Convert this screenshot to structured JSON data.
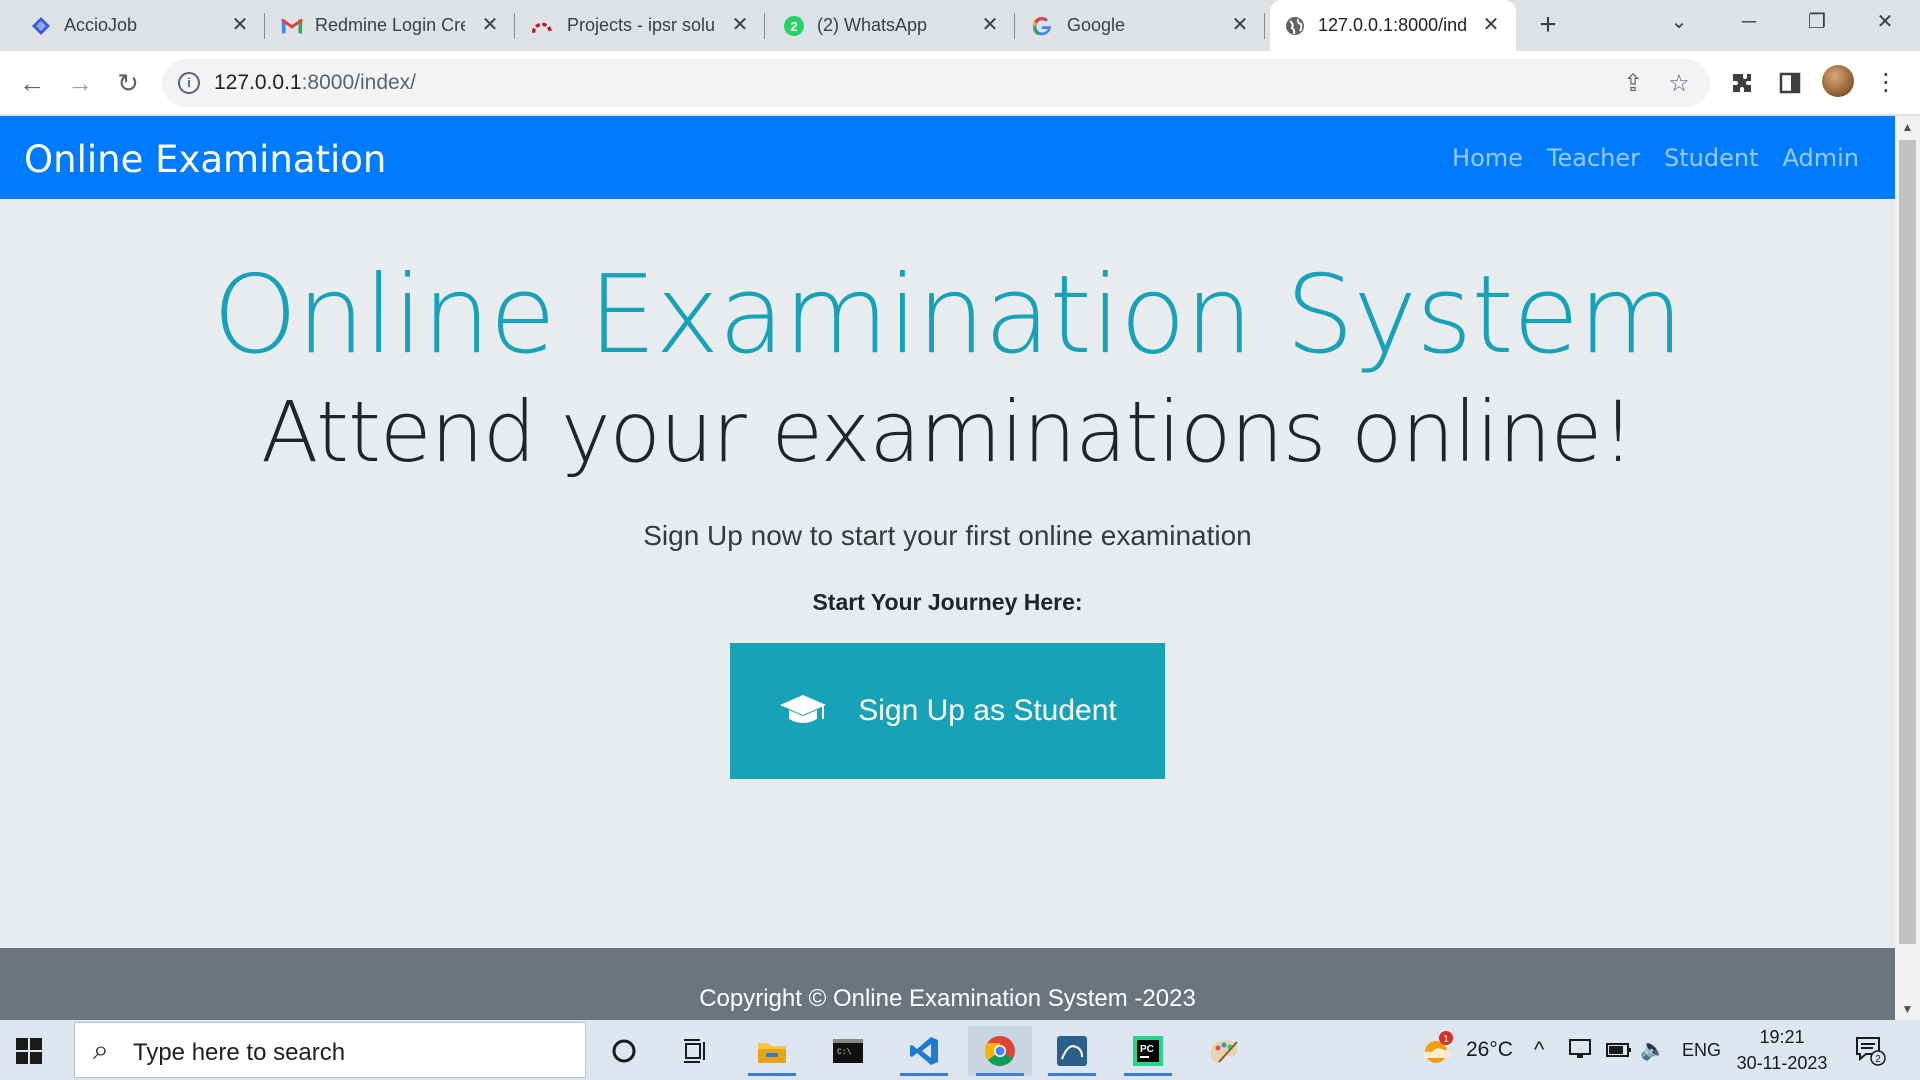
{
  "browser": {
    "tabs": [
      {
        "label": "AccioJob",
        "icon": "acciojob-logo-icon"
      },
      {
        "label": "Redmine Login Cre",
        "icon": "gmail-icon"
      },
      {
        "label": "Projects - ipsr solu",
        "icon": "redmine-icon"
      },
      {
        "label": "(2) WhatsApp",
        "icon": "whatsapp-icon",
        "badge": "2"
      },
      {
        "label": "Google",
        "icon": "google-icon"
      },
      {
        "label": "127.0.0.1:8000/ind",
        "icon": "globe-icon",
        "active": true
      }
    ],
    "address": {
      "host": "127.0.0.1",
      "path": ":8000/index/"
    }
  },
  "navbar": {
    "brand": "Online Examination",
    "links": [
      "Home",
      "Teacher",
      "Student",
      "Admin"
    ]
  },
  "hero": {
    "title": "Online Examination System",
    "subtitle": "Attend your examinations online!",
    "lead": "Sign Up now to start your first online examination",
    "journey": "Start Your Journey Here:",
    "cta_label": "Sign Up as Student"
  },
  "footer": {
    "copyright": "Copyright © Online Examination System -2023"
  },
  "taskbar": {
    "search_placeholder": "Type here to search",
    "weather_badge": "1",
    "temperature": "26°C",
    "language": "ENG",
    "time": "19:21",
    "date": "30-11-2023",
    "notification_count": "2"
  },
  "colors": {
    "navbar": "#007bff",
    "accent": "#17a2b8",
    "page_bg": "#e9ecef",
    "footer": "#6c757d"
  }
}
